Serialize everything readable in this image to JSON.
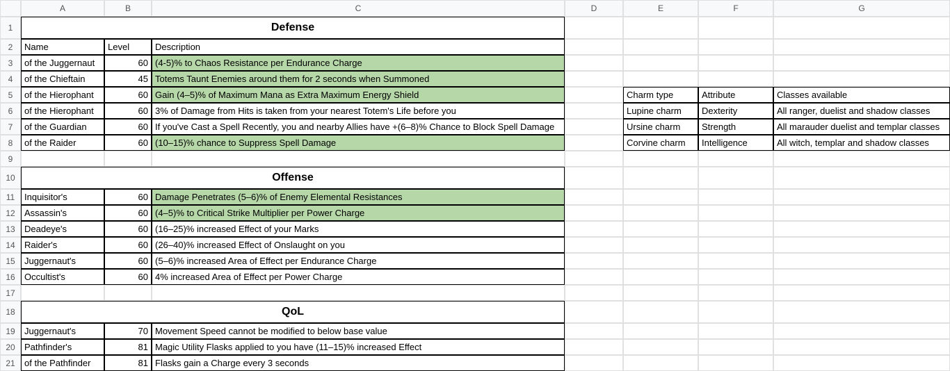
{
  "columns": [
    "A",
    "B",
    "C",
    "D",
    "E",
    "F",
    "G"
  ],
  "row_numbers": [
    1,
    2,
    3,
    4,
    5,
    6,
    7,
    8,
    9,
    10,
    11,
    12,
    13,
    14,
    15,
    16,
    17,
    18,
    19,
    20,
    21
  ],
  "sections": {
    "defense_title": "Defense",
    "offense_title": "Offense",
    "qol_title": "QoL"
  },
  "headers": {
    "name": "Name",
    "level": "Level",
    "description": "Description"
  },
  "defense_rows": [
    {
      "name": "of the Juggernaut",
      "level": 60,
      "desc": "(4-5)% to Chaos Resistance per Endurance Charge",
      "hl": true
    },
    {
      "name": "of the Chieftain",
      "level": 45,
      "desc": "Totems Taunt Enemies around them for 2 seconds when Summoned",
      "hl": true
    },
    {
      "name": "of the Hierophant",
      "level": 60,
      "desc": "Gain (4–5)% of Maximum Mana as Extra Maximum Energy Shield",
      "hl": true
    },
    {
      "name": "of the Hierophant",
      "level": 60,
      "desc": "3% of Damage from Hits is taken from your nearest Totem's Life before you",
      "hl": false
    },
    {
      "name": "of the Guardian",
      "level": 60,
      "desc": "If you've Cast a Spell Recently, you and nearby Allies have +(6–8)% Chance to Block Spell Damage",
      "hl": false
    },
    {
      "name": "of the Raider",
      "level": 60,
      "desc": "(10–15)% chance to Suppress Spell Damage",
      "hl": true
    }
  ],
  "offense_rows": [
    {
      "name": "Inquisitor's",
      "level": 60,
      "desc": "Damage Penetrates (5–6)% of Enemy Elemental Resistances",
      "hl": true
    },
    {
      "name": "Assassin's",
      "level": 60,
      "desc": "(4–5)% to Critical Strike Multiplier per Power Charge",
      "hl": true
    },
    {
      "name": "Deadeye's",
      "level": 60,
      "desc": "(16–25)% increased Effect of your Marks",
      "hl": false
    },
    {
      "name": "Raider's",
      "level": 60,
      "desc": "(26–40)% increased Effect of Onslaught on you",
      "hl": false
    },
    {
      "name": "Juggernaut's",
      "level": 60,
      "desc": "(5–6)% increased Area of Effect per Endurance Charge",
      "hl": false
    },
    {
      "name": "Occultist's",
      "level": 60,
      "desc": "4% increased Area of Effect per Power Charge",
      "hl": false
    }
  ],
  "qol_rows": [
    {
      "name": "Juggernaut's",
      "level": 70,
      "desc": "Movement Speed cannot be modified to below base value"
    },
    {
      "name": "Pathfinder's",
      "level": 81,
      "desc": "Magic Utility Flasks applied to you have (11–15)% increased Effect"
    },
    {
      "name": "of the Pathfinder",
      "level": 81,
      "desc": "Flasks gain a Charge every 3 seconds"
    }
  ],
  "charm_table": {
    "headers": {
      "type": "Charm type",
      "attr": "Attribute",
      "classes": "Classes available"
    },
    "rows": [
      {
        "type": "Lupine charm",
        "attr": "Dexterity",
        "classes": "All ranger, duelist and shadow classes"
      },
      {
        "type": "Ursine charm",
        "attr": "Strength",
        "classes": "All marauder duelist and templar classes"
      },
      {
        "type": "Corvine charm",
        "attr": "Intelligence",
        "classes": "All witch, templar and shadow classes"
      }
    ]
  },
  "chart_data": {
    "type": "table",
    "tables": [
      {
        "title": "Defense",
        "columns": [
          "Name",
          "Level",
          "Description"
        ],
        "rows": [
          [
            "of the Juggernaut",
            60,
            "(4-5)% to Chaos Resistance per Endurance Charge"
          ],
          [
            "of the Chieftain",
            45,
            "Totems Taunt Enemies around them for 2 seconds when Summoned"
          ],
          [
            "of the Hierophant",
            60,
            "Gain (4–5)% of Maximum Mana as Extra Maximum Energy Shield"
          ],
          [
            "of the Hierophant",
            60,
            "3% of Damage from Hits is taken from your nearest Totem's Life before you"
          ],
          [
            "of the Guardian",
            60,
            "If you've Cast a Spell Recently, you and nearby Allies have +(6–8)% Chance to Block Spell Damage"
          ],
          [
            "of the Raider",
            60,
            "(10–15)% chance to Suppress Spell Damage"
          ]
        ]
      },
      {
        "title": "Offense",
        "columns": [
          "Name",
          "Level",
          "Description"
        ],
        "rows": [
          [
            "Inquisitor's",
            60,
            "Damage Penetrates (5–6)% of Enemy Elemental Resistances"
          ],
          [
            "Assassin's",
            60,
            "(4–5)% to Critical Strike Multiplier per Power Charge"
          ],
          [
            "Deadeye's",
            60,
            "(16–25)% increased Effect of your Marks"
          ],
          [
            "Raider's",
            60,
            "(26–40)% increased Effect of Onslaught on you"
          ],
          [
            "Juggernaut's",
            60,
            "(5–6)% increased Area of Effect per Endurance Charge"
          ],
          [
            "Occultist's",
            60,
            "4% increased Area of Effect per Power Charge"
          ]
        ]
      },
      {
        "title": "QoL",
        "columns": [
          "Name",
          "Level",
          "Description"
        ],
        "rows": [
          [
            "Juggernaut's",
            70,
            "Movement Speed cannot be modified to below base value"
          ],
          [
            "Pathfinder's",
            81,
            "Magic Utility Flasks applied to you have (11–15)% increased Effect"
          ],
          [
            "of the Pathfinder",
            81,
            "Flasks gain a Charge every 3 seconds"
          ]
        ]
      },
      {
        "title": "Charm types",
        "columns": [
          "Charm type",
          "Attribute",
          "Classes available"
        ],
        "rows": [
          [
            "Lupine charm",
            "Dexterity",
            "All ranger, duelist and shadow classes"
          ],
          [
            "Ursine charm",
            "Strength",
            "All marauder duelist and templar classes"
          ],
          [
            "Corvine charm",
            "Intelligence",
            "All witch, templar and shadow classes"
          ]
        ]
      }
    ]
  }
}
